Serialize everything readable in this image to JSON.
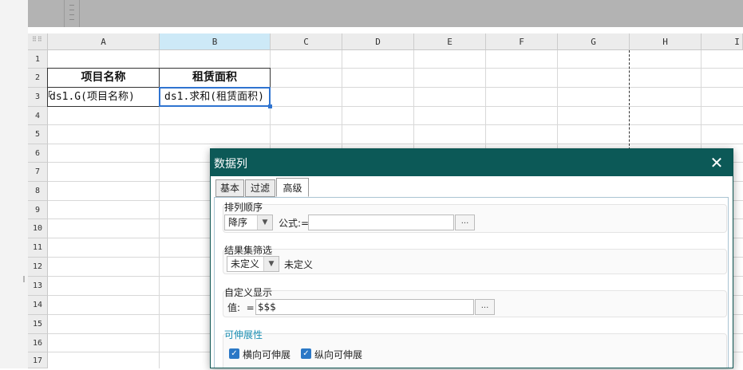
{
  "columns": [
    "A",
    "B",
    "C",
    "D",
    "E",
    "F",
    "G",
    "H",
    "I"
  ],
  "rows": [
    "1",
    "2",
    "3",
    "4",
    "5",
    "6",
    "7",
    "8",
    "9",
    "10",
    "11",
    "12",
    "13",
    "14",
    "15",
    "16",
    "17"
  ],
  "cells": {
    "A2": "项目名称",
    "B2": "租赁面积",
    "A3": "ds1.G(项目名称)",
    "B3": "ds1.求和(租赁面积)"
  },
  "dialog": {
    "title": "数据列",
    "close_icon": "close-icon",
    "tabs": [
      "基本",
      "过滤",
      "高级"
    ],
    "active_tab": "高级",
    "sort_group": {
      "label": "排列顺序",
      "order_value": "降序",
      "formula_label": "公式:=",
      "formula_value": "",
      "dots_label": "..."
    },
    "filter_group": {
      "label": "结果集筛选",
      "value": "未定义",
      "value_text": "未定义"
    },
    "display_group": {
      "label": "自定义显示",
      "value_label": "值:  =",
      "value": "$$$",
      "dots_label": "..."
    },
    "expand_group": {
      "label": "可伸展性",
      "horizontal_label": "横向可伸展",
      "vertical_label": "纵向可伸展",
      "horizontal_checked": true,
      "vertical_checked": true
    }
  },
  "colors": {
    "dialog_title_bg": "#0c5957",
    "selection_border": "#2f74d0",
    "selected_col_header": "#cde9f7",
    "accent_label": "#1d8fb3",
    "checkbox": "#2b78c6"
  }
}
